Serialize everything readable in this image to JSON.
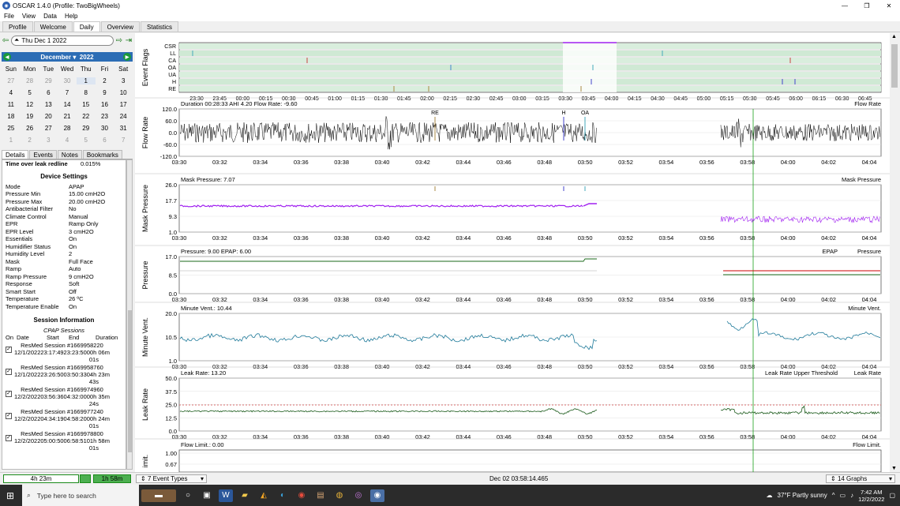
{
  "window": {
    "title": "OSCAR 1.4.0 (Profile: TwoBigWheels)",
    "controls": [
      "—",
      "❐",
      "✕"
    ]
  },
  "menu": [
    "File",
    "View",
    "Data",
    "Help"
  ],
  "tabs": [
    {
      "label": "Profile"
    },
    {
      "label": "Welcome"
    },
    {
      "label": "Daily",
      "active": true
    },
    {
      "label": "Overview"
    },
    {
      "label": "Statistics"
    }
  ],
  "datebar": {
    "back": "⇦",
    "date": "Thu Dec 1 2022",
    "forward": "⇨",
    "last": "⇥"
  },
  "calendar": {
    "month": "December",
    "year": "2022",
    "weekdays": [
      "Sun",
      "Mon",
      "Tue",
      "Wed",
      "Thu",
      "Fri",
      "Sat"
    ],
    "weeks": [
      [
        "27",
        "28",
        "29",
        "30",
        "1",
        "2",
        "3"
      ],
      [
        "4",
        "5",
        "6",
        "7",
        "8",
        "9",
        "10"
      ],
      [
        "11",
        "12",
        "13",
        "14",
        "15",
        "16",
        "17"
      ],
      [
        "18",
        "19",
        "20",
        "21",
        "22",
        "23",
        "24"
      ],
      [
        "25",
        "26",
        "27",
        "28",
        "29",
        "30",
        "31"
      ],
      [
        "1",
        "2",
        "3",
        "4",
        "5",
        "6",
        "7"
      ]
    ]
  },
  "left_tabs": [
    "Details",
    "Events",
    "Notes",
    "Bookmarks"
  ],
  "details": {
    "leak_redline_label": "Time over leak redline",
    "leak_redline_value": "0.015%",
    "device_title": "Device Settings",
    "settings": [
      [
        "Mode",
        "APAP"
      ],
      [
        "Pressure Min",
        "15.00 cmH2O"
      ],
      [
        "Pressure Max",
        "20.00 cmH2O"
      ],
      [
        "Antibacterial Filter",
        "No"
      ],
      [
        "Climate Control",
        "Manual"
      ],
      [
        "EPR",
        "Ramp Only"
      ],
      [
        "EPR Level",
        "3 cmH2O"
      ],
      [
        "Essentials",
        "On"
      ],
      [
        "Humidifier Status",
        "On"
      ],
      [
        "Humidity Level",
        "2"
      ],
      [
        "Mask",
        "Full Face"
      ],
      [
        "Ramp",
        "Auto"
      ],
      [
        "Ramp Pressure",
        "9 cmH2O"
      ],
      [
        "Response",
        "Soft"
      ],
      [
        "Smart Start",
        "Off"
      ],
      [
        "Temperature",
        "26 ºC"
      ],
      [
        "Temperature Enable",
        "On"
      ]
    ],
    "session_title": "Session Information",
    "cpap_sessions": "CPAP Sessions",
    "session_headers": [
      "On",
      "Date",
      "Start",
      "End",
      "Duration"
    ],
    "sessions": [
      {
        "name": "ResMed Session #1669958220",
        "line": "12/1/202223:17:4923:23:5000h 06m",
        "tail": "01s"
      },
      {
        "name": "ResMed Session #1669958760",
        "line": "12/1/202223:26:5003:50:3304h 23m",
        "tail": "43s"
      },
      {
        "name": "ResMed Session #1669974960",
        "line": "12/2/202203:56:3604:32:0000h 35m",
        "tail": "24s"
      },
      {
        "name": "ResMed Session #1669977240",
        "line": "12/2/202204:34:1904:58:2000h 24m",
        "tail": "01s"
      },
      {
        "name": "ResMed Session #1669978800",
        "line": "12/2/202205:00:5006:58:5101h 58m",
        "tail": "01s"
      }
    ]
  },
  "bottom": {
    "dur1": "4h 23m",
    "dur2": "1h 58m",
    "event_types": "7 Event Types",
    "status": "Dec 02 03:58:14.465",
    "graphs": "14 Graphs"
  },
  "taskbar": {
    "search": "Type here to search",
    "weather": "37°F  Partly sunny",
    "time": "7:42 AM",
    "date": "12/2/2022"
  },
  "graphs": {
    "event_flags": {
      "title": "Event Flags",
      "labels": [
        "CSR",
        "LL",
        "CA",
        "OA",
        "UA",
        "H",
        "RE"
      ],
      "times": [
        "23:30",
        "23:45",
        "00:00",
        "00:15",
        "00:30",
        "00:45",
        "01:00",
        "01:15",
        "01:30",
        "01:45",
        "02:00",
        "02:15",
        "02:30",
        "02:45",
        "03:00",
        "03:15",
        "03:30",
        "03:45",
        "04:00",
        "04:15",
        "04:30",
        "04:45",
        "05:00",
        "05:15",
        "05:30",
        "05:45",
        "06:00",
        "06:15",
        "06:30",
        "06:45"
      ]
    },
    "detail_times": [
      "03:30",
      "03:32",
      "03:34",
      "03:36",
      "03:38",
      "03:40",
      "03:42",
      "03:44",
      "03:46",
      "03:48",
      "03:50",
      "03:52",
      "03:54",
      "03:56",
      "03:58",
      "04:00",
      "04:02",
      "04:04"
    ],
    "flow": {
      "title": "Flow Rate",
      "header": "Duration 00:28:33 AHI 4.20 Flow Rate: -9.60",
      "legend": "Flow Rate",
      "ticks": [
        "120.0",
        "60.0",
        "0.0",
        "-60.0",
        "-120.0"
      ],
      "markers": [
        "RE",
        "H",
        "OA"
      ]
    },
    "mask": {
      "title": "Mask Pressure",
      "header": "Mask Pressure: 7.07",
      "legend": "Mask Pressure",
      "ticks": [
        "26.0",
        "17.7",
        "9.3",
        "1.0"
      ]
    },
    "pressure": {
      "title": "Pressure",
      "header": "Pressure: 9.00 EPAP: 6.00",
      "legend": "EPAP",
      "legend2": "Pressure",
      "ticks": [
        "17.0",
        "8.5",
        "0.0"
      ]
    },
    "minute": {
      "title": "Minute Vent.",
      "header": "Minute Vent.: 10.44",
      "legend": "Minute Vent.",
      "ticks": [
        "20.0",
        "10.5",
        "1.0"
      ]
    },
    "leak": {
      "title": "Leak Rate",
      "header": "Leak Rate: 13.20",
      "legend": "Leak Rate Upper Threshold",
      "legend2": "Leak Rate",
      "ticks": [
        "50.0",
        "37.5",
        "25.0",
        "12.5",
        "0.0"
      ]
    },
    "flowlimit": {
      "title": "imit.",
      "header": "Flow Limit.: 0.00",
      "legend": "Flow Limit.",
      "ticks": [
        "1.00",
        "0.67"
      ]
    }
  }
}
